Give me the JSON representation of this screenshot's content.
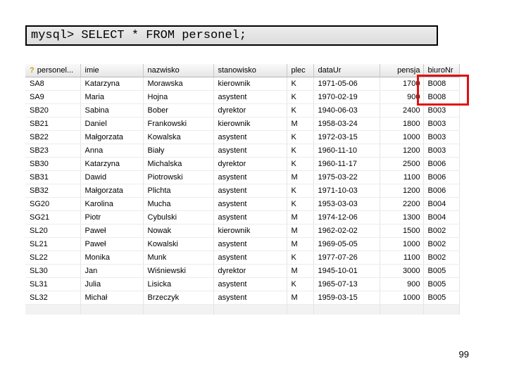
{
  "query": "mysql> SELECT * FROM personel;",
  "page_number": "99",
  "colors": {
    "highlight": "#e01010",
    "key_icon": "#c9a400"
  },
  "columns": [
    {
      "label": "personel...",
      "key": true
    },
    {
      "label": "imie"
    },
    {
      "label": "nazwisko"
    },
    {
      "label": "stanowisko"
    },
    {
      "label": "plec"
    },
    {
      "label": "dataUr"
    },
    {
      "label": "pensja"
    },
    {
      "label": "biuroNr"
    }
  ],
  "rows": [
    [
      "SA8",
      "Katarzyna",
      "Morawska",
      "kierownik",
      "K",
      "1971-05-06",
      "1700",
      "B008"
    ],
    [
      "SA9",
      "Maria",
      "Hojna",
      "asystent",
      "K",
      "1970-02-19",
      "900",
      "B008"
    ],
    [
      "SB20",
      "Sabina",
      "Bober",
      "dyrektor",
      "K",
      "1940-06-03",
      "2400",
      "B003"
    ],
    [
      "SB21",
      "Daniel",
      "Frankowski",
      "kierownik",
      "M",
      "1958-03-24",
      "1800",
      "B003"
    ],
    [
      "SB22",
      "Małgorzata",
      "Kowalska",
      "asystent",
      "K",
      "1972-03-15",
      "1000",
      "B003"
    ],
    [
      "SB23",
      "Anna",
      "Biały",
      "asystent",
      "K",
      "1960-11-10",
      "1200",
      "B003"
    ],
    [
      "SB30",
      "Katarzyna",
      "Michalska",
      "dyrektor",
      "K",
      "1960-11-17",
      "2500",
      "B006"
    ],
    [
      "SB31",
      "Dawid",
      "Piotrowski",
      "asystent",
      "M",
      "1975-03-22",
      "1100",
      "B006"
    ],
    [
      "SB32",
      "Małgorzata",
      "Plichta",
      "asystent",
      "K",
      "1971-10-03",
      "1200",
      "B006"
    ],
    [
      "SG20",
      "Karolina",
      "Mucha",
      "asystent",
      "K",
      "1953-03-03",
      "2200",
      "B004"
    ],
    [
      "SG21",
      "Piotr",
      "Cybulski",
      "asystent",
      "M",
      "1974-12-06",
      "1300",
      "B004"
    ],
    [
      "SL20",
      "Paweł",
      "Nowak",
      "kierownik",
      "M",
      "1962-02-02",
      "1500",
      "B002"
    ],
    [
      "SL21",
      "Paweł",
      "Kowalski",
      "asystent",
      "M",
      "1969-05-05",
      "1000",
      "B002"
    ],
    [
      "SL22",
      "Monika",
      "Munk",
      "asystent",
      "K",
      "1977-07-26",
      "1100",
      "B002"
    ],
    [
      "SL30",
      "Jan",
      "Wiśniewski",
      "dyrektor",
      "M",
      "1945-10-01",
      "3000",
      "B005"
    ],
    [
      "SL31",
      "Julia",
      "Lisicka",
      "asystent",
      "K",
      "1965-07-13",
      "900",
      "B005"
    ],
    [
      "SL32",
      "Michał",
      "Brzeczyk",
      "asystent",
      "M",
      "1959-03-15",
      "1000",
      "B005"
    ]
  ]
}
